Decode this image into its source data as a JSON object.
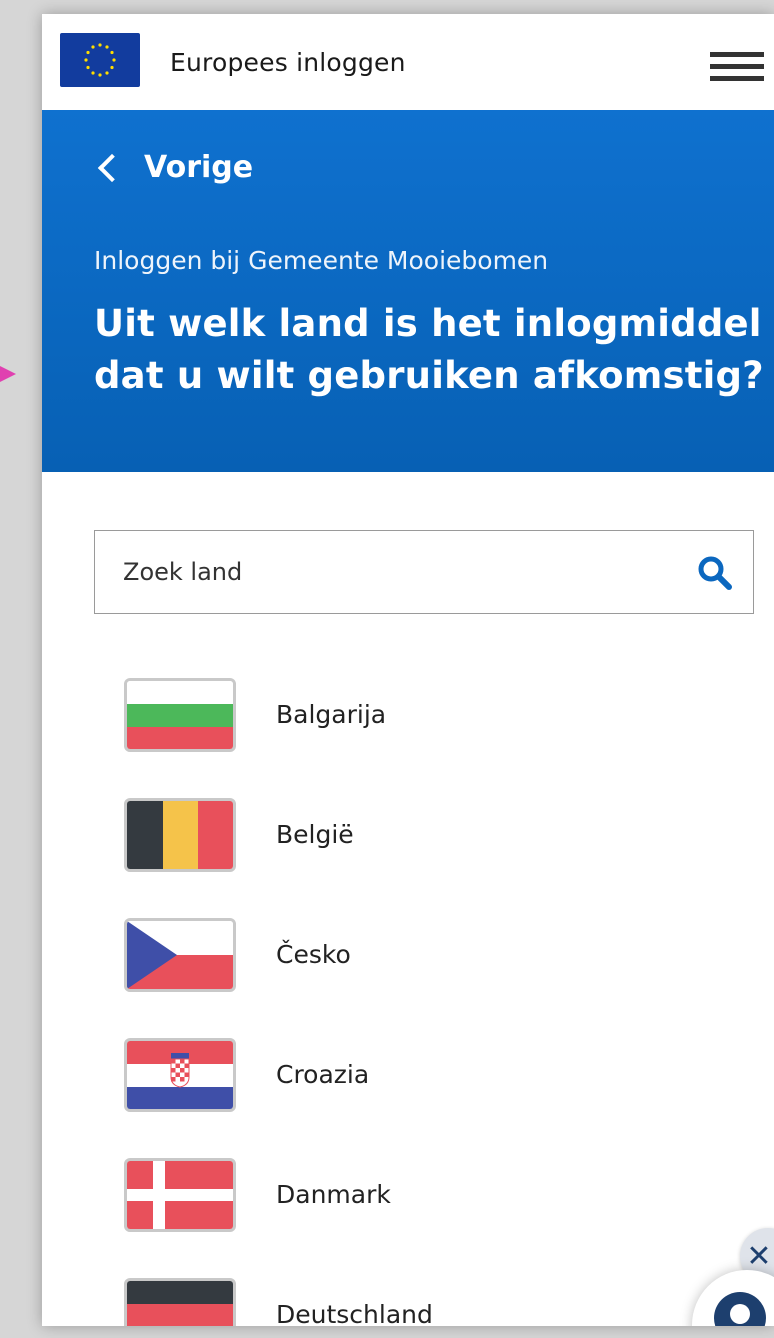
{
  "header": {
    "app_title": "Europees inloggen",
    "logo_icon": "eu-flag-icon",
    "menu_icon": "hamburger-menu-icon"
  },
  "hero": {
    "back_label": "Vorige",
    "subtitle": "Inloggen bij Gemeente Mooiebomen",
    "heading": "Uit welk land is het inlogmiddel dat u wilt gebruiken afkomstig?"
  },
  "search": {
    "placeholder": "Zoek land",
    "value": ""
  },
  "countries": [
    {
      "name": "Balgarija",
      "flag": "bulgaria-flag-icon"
    },
    {
      "name": "België",
      "flag": "belgium-flag-icon"
    },
    {
      "name": "Česko",
      "flag": "czech-flag-icon"
    },
    {
      "name": "Croazia",
      "flag": "croatia-flag-icon"
    },
    {
      "name": "Danmark",
      "flag": "denmark-flag-icon"
    },
    {
      "name": "Deutschland",
      "flag": "germany-flag-icon"
    }
  ],
  "chat": {
    "close_icon": "close-icon",
    "avatar_icon": "chat-avatar-icon"
  },
  "colors": {
    "hero_blue": "#0b67bf",
    "eu_blue": "#123c9e",
    "flag_red": "#e8505b",
    "flag_green": "#4cb85a",
    "flag_yellow": "#f5c34a",
    "flag_dark": "#343a40",
    "flag_blue": "#3f4fa8"
  }
}
